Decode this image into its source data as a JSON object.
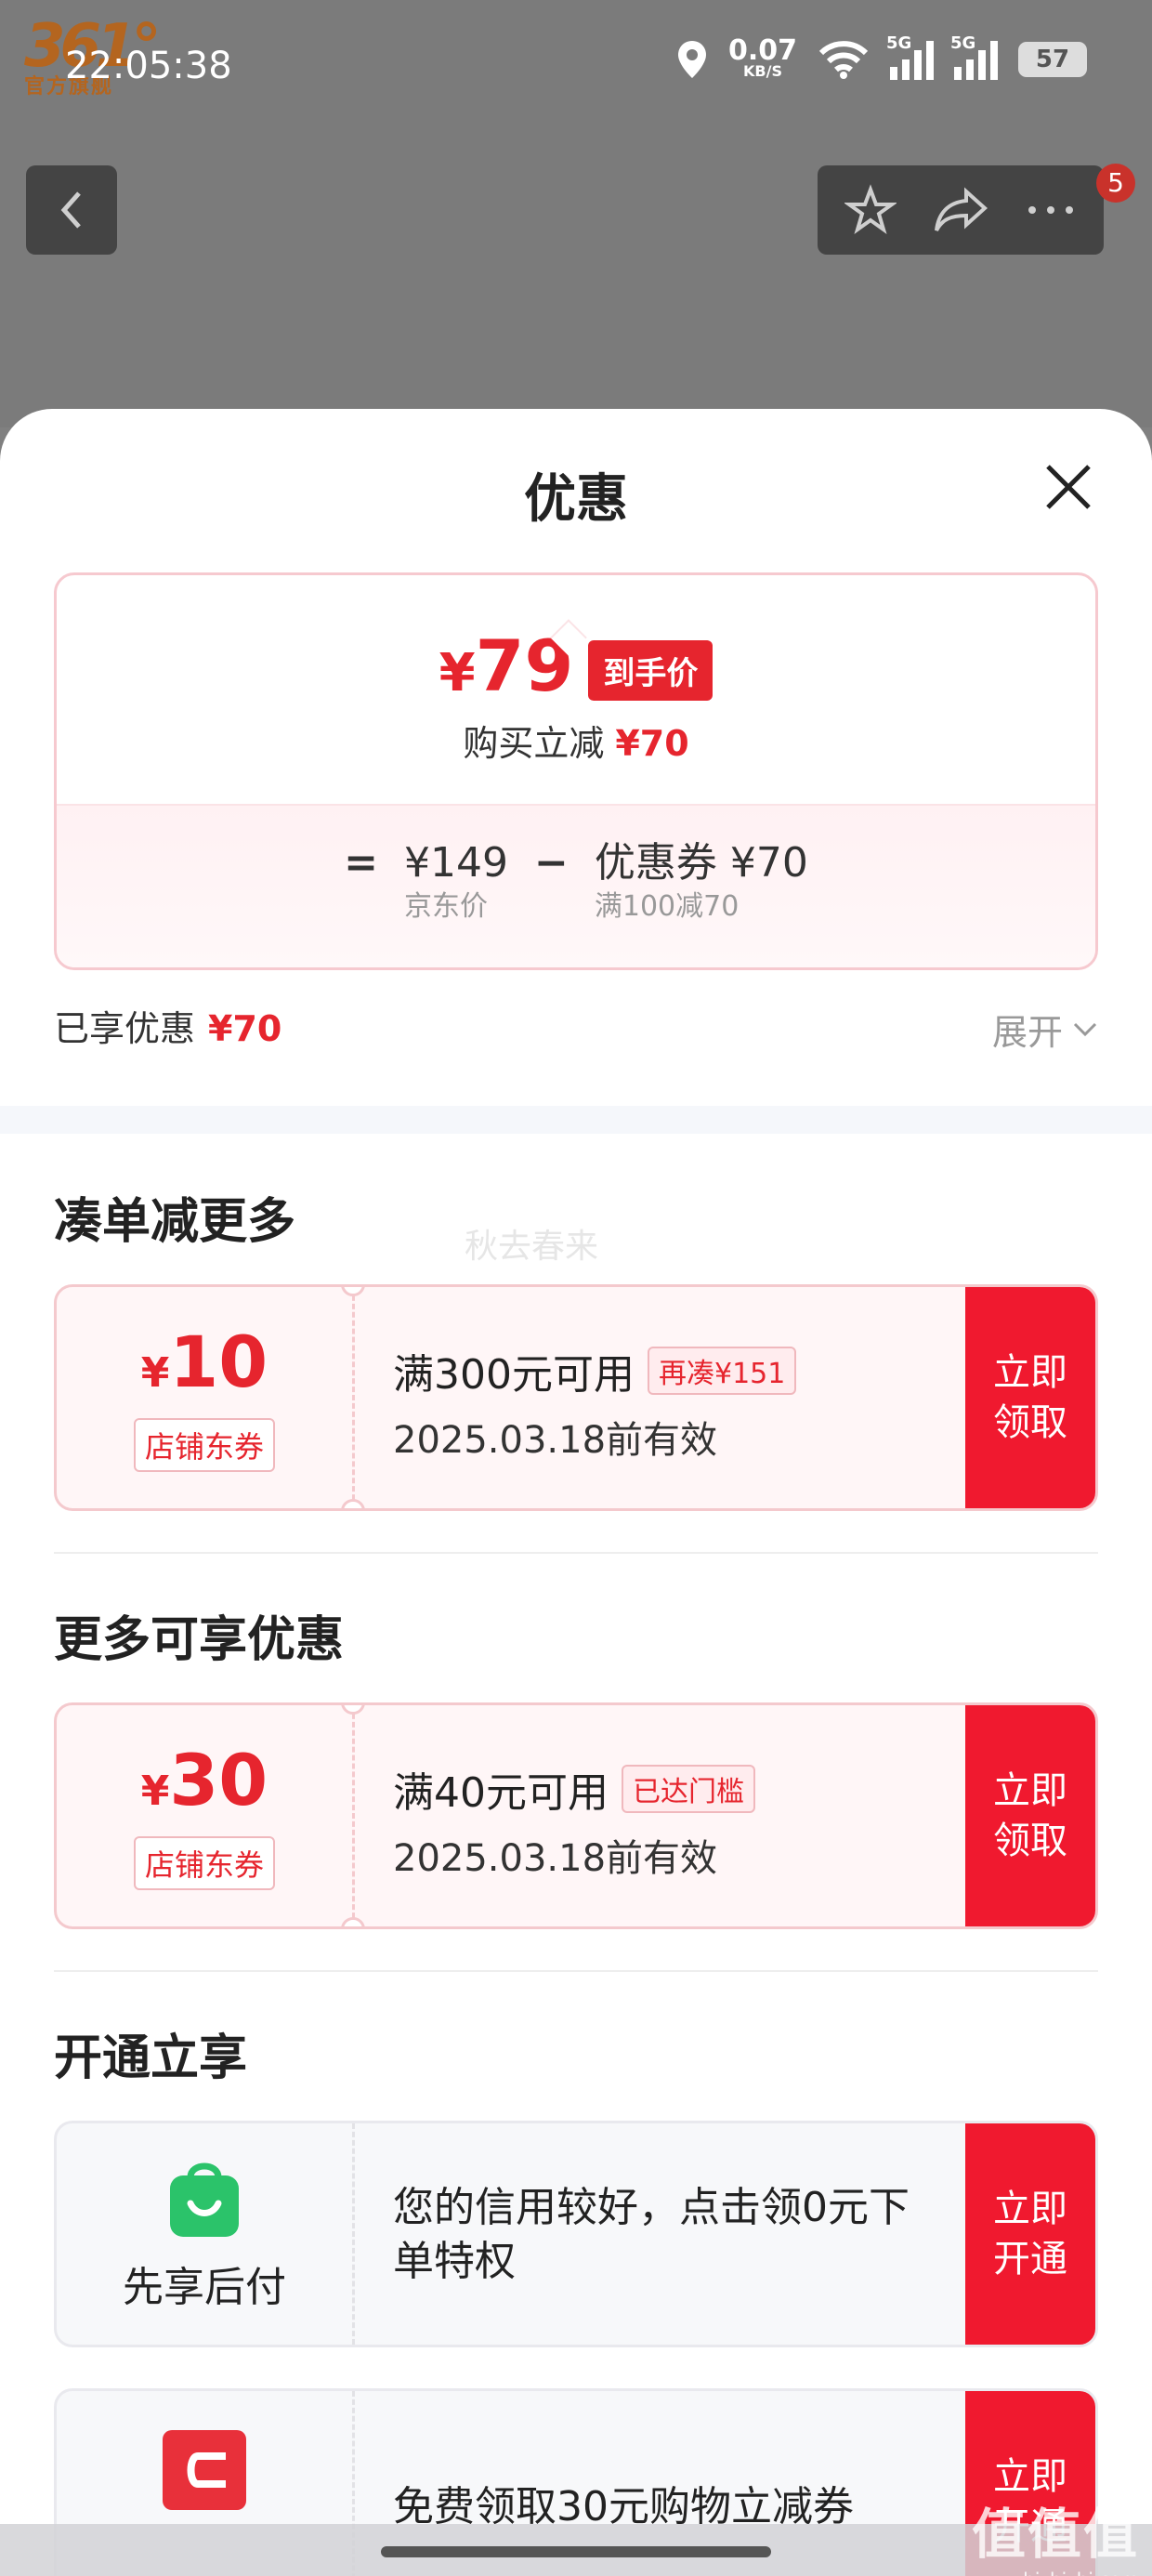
{
  "status_bar": {
    "time": "22:05:38",
    "speed_value": "0.07",
    "speed_unit": "KB/S",
    "signal1": "5G",
    "signal2": "5G",
    "battery": "57"
  },
  "background_page": {
    "brand_logo_top": "361°",
    "brand_logo_bottom": "官方旗舰",
    "notification_count": "5"
  },
  "sheet": {
    "title": "优惠",
    "price_card": {
      "final_price_symbol": "¥",
      "final_price": "79",
      "final_tag": "到手价",
      "sub_label": "购买立减",
      "sub_amount": "¥70",
      "equals": "=",
      "minus": "−",
      "jd_price": "¥149",
      "jd_price_label": "京东价",
      "coupon_value": "优惠券 ¥70",
      "coupon_rule": "满100减70"
    },
    "saved_label": "已享优惠",
    "saved_amount": "¥70",
    "expand_label": "展开"
  },
  "sections": {
    "combine_title": "凑单减更多",
    "watermark": "秋去春来",
    "more_title": "更多可享优惠",
    "open_title": "开通立享"
  },
  "coupons": [
    {
      "currency": "¥",
      "amount": "10",
      "type": "店铺东券",
      "condition": "满300元可用",
      "pill": "再凑¥151",
      "valid": "2025.03.18前有效",
      "button": "立即\n领取"
    },
    {
      "currency": "¥",
      "amount": "30",
      "type": "店铺东券",
      "condition": "满40元可用",
      "pill": "已达门槛",
      "valid": "2025.03.18前有效",
      "button": "立即\n领取"
    }
  ],
  "promos": [
    {
      "icon": "shopping-bag-icon",
      "label": "先享后付",
      "text": "您的信用较好，点击领0元下单特权",
      "button": "立即\n开通",
      "icon_color": "#2bc36a"
    },
    {
      "icon": "card-icon",
      "label": "",
      "text": "免费领取30元购物立减券",
      "button": "立即\n开通",
      "icon_color": "#e8303a"
    }
  ],
  "site_mark": {
    "logo": "值值值",
    "url": "zhizhizhi.com"
  },
  "colors": {
    "accent_red": "#e6252e",
    "button_red": "#f0192f",
    "pay_green": "#2bc36a"
  }
}
